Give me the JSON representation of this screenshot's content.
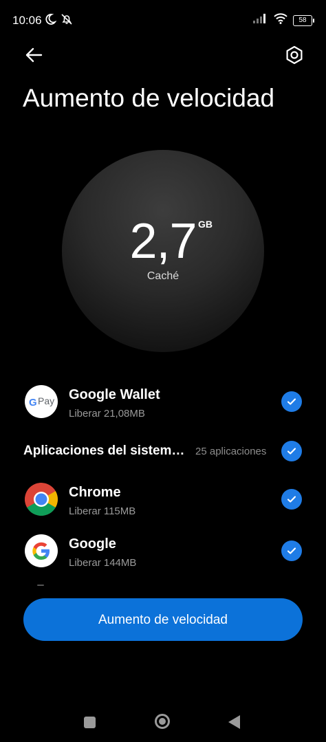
{
  "status_bar": {
    "time": "10:06",
    "battery": "58",
    "icons": [
      "moon-icon",
      "bell-off-icon",
      "signal-icon",
      "wifi-icon",
      "battery-icon"
    ]
  },
  "header": {
    "title": "Aumento de velocidad",
    "back_icon": "arrow-left-icon",
    "settings_icon": "gear-icon"
  },
  "cache": {
    "value": "2,7",
    "unit": "GB",
    "label": "Caché"
  },
  "apps": [
    {
      "name": "Google Wallet",
      "detail": "Liberar 21,08MB",
      "icon": "google-pay-icon",
      "icon_text": "Pay",
      "checked": true
    },
    {
      "name": "Chrome",
      "detail": "Liberar 115MB",
      "icon": "chrome-icon",
      "checked": true
    },
    {
      "name": "Google",
      "detail": "Liberar 144MB",
      "icon": "google-icon",
      "checked": true
    }
  ],
  "system_section": {
    "title": "Aplicaciones del sistem…",
    "count": "25 aplicaciones",
    "checked": true
  },
  "action_button": {
    "label": "Aumento de velocidad"
  },
  "colors": {
    "accent": "#1f7ce6",
    "button": "#0c72d9",
    "background": "#000000"
  }
}
